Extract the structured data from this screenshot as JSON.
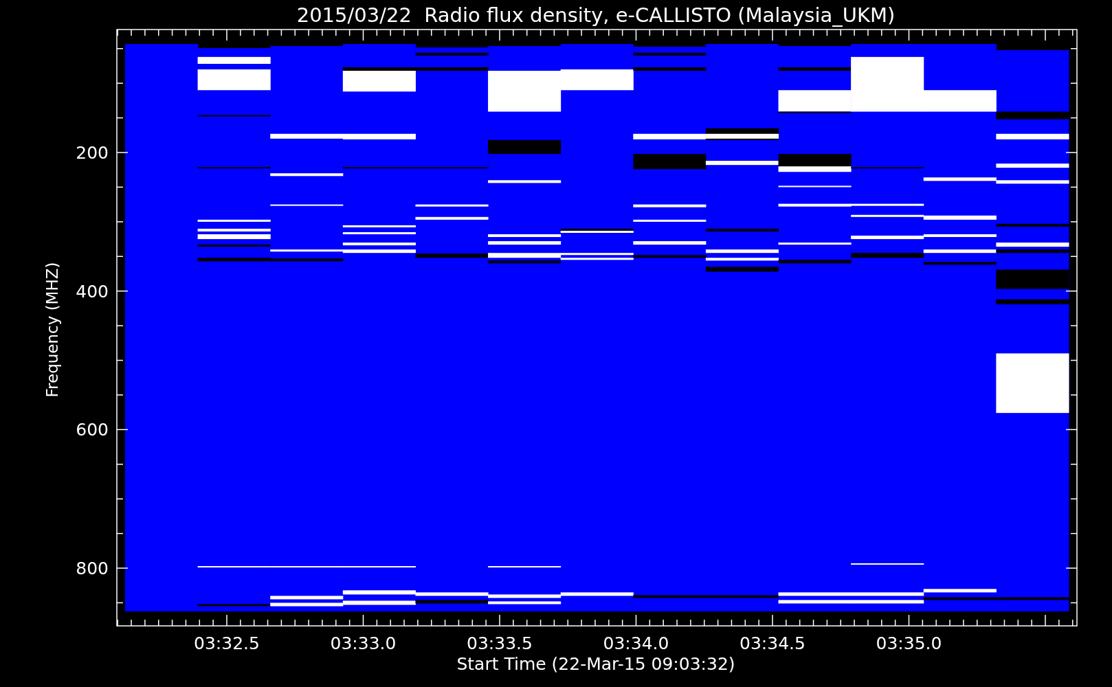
{
  "chart": {
    "title": "2015/03/22  Radio flux density, e-CALLISTO (Malaysia_UKM)",
    "xlabel": "Start Time (22-Mar-15 09:03:32)",
    "ylabel": "Frequency (MHZ)",
    "xticks": [
      "03:32.5",
      "03:33.0",
      "03:33.5",
      "03:34.0",
      "03:34.5",
      "03:35.0"
    ],
    "yticks": [
      "200",
      "400",
      "600",
      "800"
    ]
  }
}
